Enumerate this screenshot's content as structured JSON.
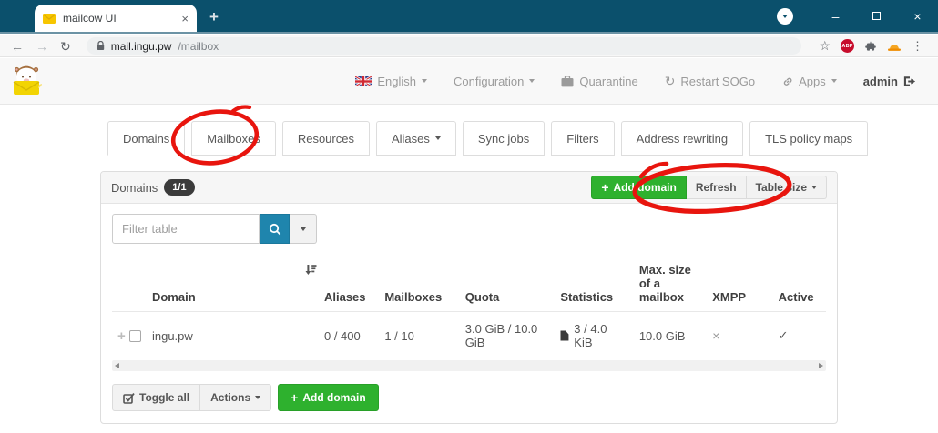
{
  "browser": {
    "tab_title": "mailcow UI",
    "url_host": "mail.ingu.pw",
    "url_path": "/mailbox",
    "adblock_badge": "ABP"
  },
  "icons": {
    "back": "←",
    "forward": "→",
    "reload": "↻",
    "star": "☆",
    "menu_dots": "⋮",
    "minimize": "–",
    "close": "×",
    "new_tab": "+",
    "restart": "↻",
    "plus": "+",
    "expand_row": "+"
  },
  "header_nav": {
    "language": "English",
    "configuration": "Configuration",
    "quarantine": "Quarantine",
    "restart_sogo": "Restart SOGo",
    "apps": "Apps",
    "admin": "admin"
  },
  "tabs": [
    {
      "label": "Domains",
      "active": true
    },
    {
      "label": "Mailboxes",
      "active": false
    },
    {
      "label": "Resources",
      "active": false
    },
    {
      "label": "Aliases",
      "active": false,
      "has_caret": true
    },
    {
      "label": "Sync jobs",
      "active": false
    },
    {
      "label": "Filters",
      "active": false
    },
    {
      "label": "Address rewriting",
      "active": false
    },
    {
      "label": "TLS policy maps",
      "active": false
    }
  ],
  "panel": {
    "title": "Domains",
    "count_badge": "1/1",
    "buttons": {
      "add_domain": "Add domain",
      "refresh": "Refresh",
      "table_size": "Table size"
    },
    "filter_placeholder": "Filter table",
    "table": {
      "headers": [
        "Domain",
        "Aliases",
        "Mailboxes",
        "Quota",
        "Statistics",
        "Max. size of a mailbox",
        "XMPP",
        "Active"
      ],
      "row": {
        "domain": "ingu.pw",
        "aliases": "0 / 400",
        "mailboxes": "1 / 10",
        "quota": "3.0 GiB / 10.0 GiB",
        "statistics": "3 / 4.0 KiB",
        "max_size": "10.0 GiB",
        "xmpp": "×",
        "active": "✓"
      }
    },
    "footer": {
      "toggle_all": "Toggle all",
      "actions": "Actions",
      "add_domain": "Add domain"
    }
  },
  "colors": {
    "chrome_bar": "#0B506C",
    "green_button": "#2EB12E",
    "search_button": "#1F85AD",
    "annotation_red": "#E8150E",
    "badge_bg": "#3B3B3B"
  }
}
